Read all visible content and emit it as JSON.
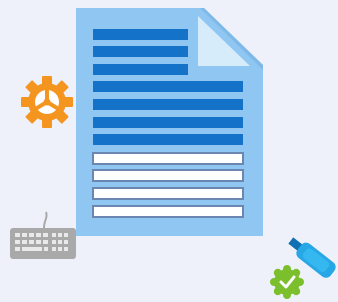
{
  "illustration": {
    "colors": {
      "background": "#eef1f9",
      "document_fill": "#8fc6f2",
      "document_fold": "#d6ecfb",
      "filled_line": "#1473c8",
      "empty_line_fill": "#ffffff",
      "empty_line_stroke": "#6b86b1",
      "gear": "#f49520",
      "keyboard": "#a9a9a9",
      "keyboard_keys": "#e9e9e9",
      "pen_body": "#27a7e5",
      "pen_tip": "#0e6fb2",
      "check_badge": "#7bbf2c",
      "checkmark": "#ffffff"
    },
    "icons": {
      "document": "document-icon",
      "gear": "gear-icon",
      "keyboard": "keyboard-icon",
      "pen": "pen-icon",
      "check": "check-badge-icon"
    },
    "document": {
      "filled_line_count": 7,
      "empty_field_count": 4
    }
  }
}
